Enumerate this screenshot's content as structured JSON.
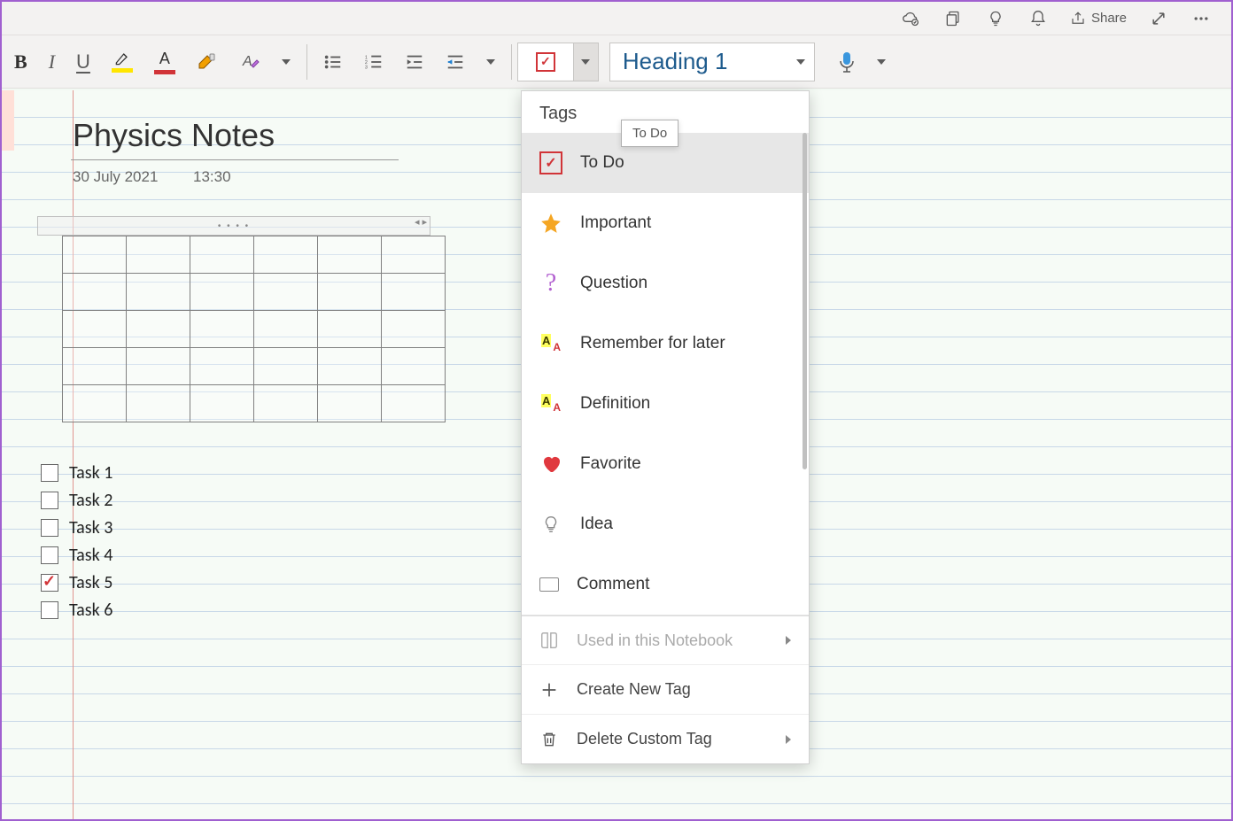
{
  "titlebar": {
    "share": "Share"
  },
  "ribbon": {
    "bold": "B",
    "italic": "I",
    "underline": "U",
    "fontcolor_letter": "A",
    "style_selector": "Heading 1"
  },
  "page": {
    "title": "Physics Notes",
    "date": "30 July 2021",
    "time": "13:30",
    "tasks": [
      {
        "label": "Task 1",
        "checked": false
      },
      {
        "label": "Task 2",
        "checked": false
      },
      {
        "label": "Task 3",
        "checked": false
      },
      {
        "label": "Task 4",
        "checked": false
      },
      {
        "label": "Task 5",
        "checked": true
      },
      {
        "label": "Task 6",
        "checked": false
      }
    ]
  },
  "tags_panel": {
    "title": "Tags",
    "tooltip": "To Do",
    "items": [
      {
        "label": "To Do",
        "icon": "todo",
        "selected": true
      },
      {
        "label": "Important",
        "icon": "star"
      },
      {
        "label": "Question",
        "icon": "question"
      },
      {
        "label": "Remember for later",
        "icon": "remember"
      },
      {
        "label": "Definition",
        "icon": "definition"
      },
      {
        "label": "Favorite",
        "icon": "heart"
      },
      {
        "label": "Idea",
        "icon": "bulb"
      },
      {
        "label": "Comment",
        "icon": "comment"
      }
    ],
    "footer": {
      "used": "Used in this Notebook",
      "create": "Create New Tag",
      "delete": "Delete Custom Tag"
    }
  }
}
